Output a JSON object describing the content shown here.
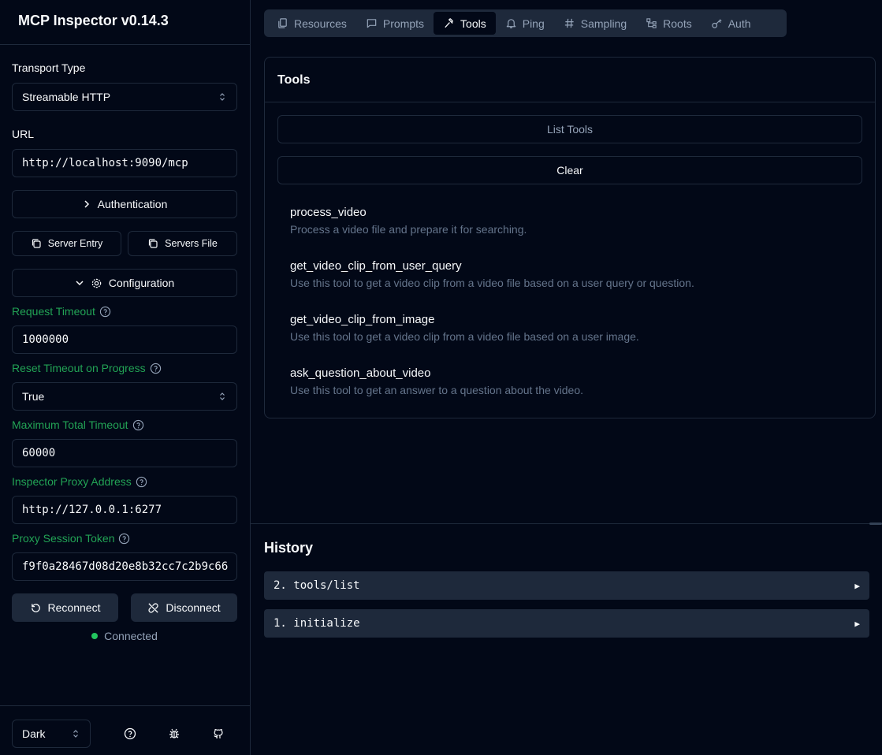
{
  "app": {
    "title": "MCP Inspector v0.14.3"
  },
  "sidebar": {
    "transport_label": "Transport Type",
    "transport_value": "Streamable HTTP",
    "url_label": "URL",
    "url_value": "http://localhost:9090/mcp",
    "authentication_label": "Authentication",
    "server_entry_label": "Server Entry",
    "servers_file_label": "Servers File",
    "configuration_label": "Configuration",
    "request_timeout_label": "Request Timeout",
    "request_timeout_value": "1000000",
    "reset_timeout_label": "Reset Timeout on Progress",
    "reset_timeout_value": "True",
    "max_timeout_label": "Maximum Total Timeout",
    "max_timeout_value": "60000",
    "proxy_address_label": "Inspector Proxy Address",
    "proxy_address_value": "http://127.0.0.1:6277",
    "session_token_label": "Proxy Session Token",
    "session_token_value": "f9f0a28467d08d20e8b32cc7c2b9c66",
    "reconnect_label": "Reconnect",
    "disconnect_label": "Disconnect",
    "status": "Connected",
    "theme_value": "Dark"
  },
  "tabs": [
    {
      "label": "Resources",
      "icon": "files-icon"
    },
    {
      "label": "Prompts",
      "icon": "message-icon"
    },
    {
      "label": "Tools",
      "icon": "hammer-icon",
      "active": true
    },
    {
      "label": "Ping",
      "icon": "bell-icon"
    },
    {
      "label": "Sampling",
      "icon": "hash-icon"
    },
    {
      "label": "Roots",
      "icon": "tree-icon"
    },
    {
      "label": "Auth",
      "icon": "key-icon"
    }
  ],
  "tools_panel": {
    "title": "Tools",
    "list_button": "List Tools",
    "clear_button": "Clear",
    "tools": [
      {
        "name": "process_video",
        "description": "Process a video file and prepare it for searching."
      },
      {
        "name": "get_video_clip_from_user_query",
        "description": "Use this tool to get a video clip from a video file based on a user query or question."
      },
      {
        "name": "get_video_clip_from_image",
        "description": "Use this tool to get a video clip from a video file based on a user image."
      },
      {
        "name": "ask_question_about_video",
        "description": "Use this tool to get an answer to a question about the video."
      }
    ]
  },
  "history": {
    "title": "History",
    "items": [
      {
        "label": "2. tools/list",
        "expand": "▶"
      },
      {
        "label": "1. initialize",
        "expand": "▶"
      }
    ]
  },
  "colors": {
    "background": "#020817",
    "border": "#1e293b",
    "accent_green": "#22a355",
    "status_green": "#22c55e"
  }
}
